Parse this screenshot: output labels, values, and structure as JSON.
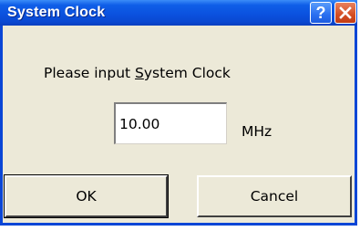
{
  "dialog": {
    "title": "System Clock",
    "help_glyph": "?",
    "prompt_before": "Please input ",
    "prompt_mnemonic": "S",
    "prompt_after": "ystem Clock",
    "input_value": "10.00",
    "unit": "MHz",
    "ok_label": "OK",
    "cancel_label": "Cancel"
  },
  "colors": {
    "titlebar": "#0b52df",
    "close_button": "#d44d23",
    "dialog_face": "#ece9d8"
  }
}
